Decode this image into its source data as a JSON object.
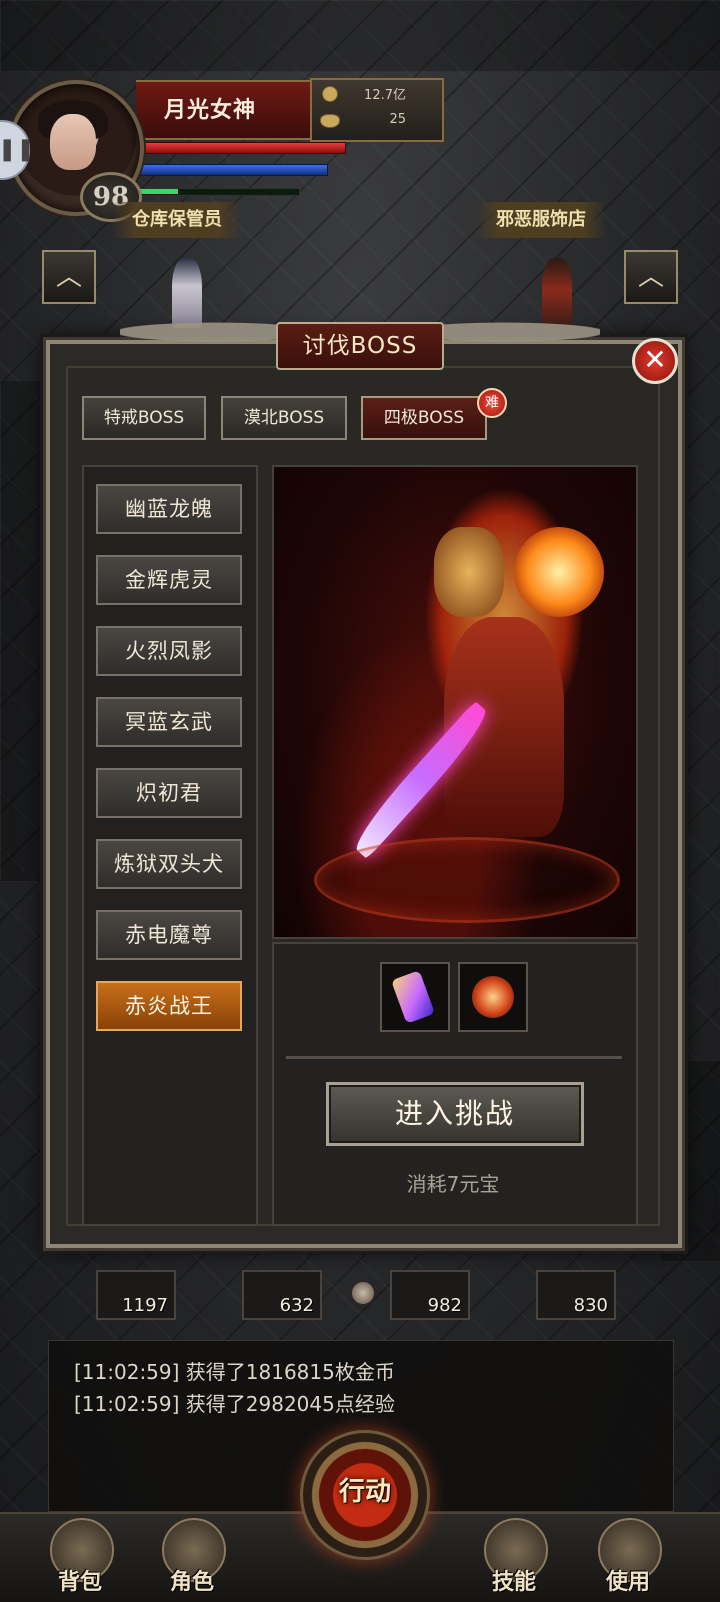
{
  "player": {
    "name": "月光女神",
    "level": "98",
    "gold": "12.7亿",
    "ingots": "25"
  },
  "npc_labels": {
    "left": "仓库保管员",
    "right": "邪恶服饰店"
  },
  "modal": {
    "title": "讨伐BOSS",
    "tabs": [
      {
        "label": "特戒BOSS",
        "active": false
      },
      {
        "label": "漠北BOSS",
        "active": false
      },
      {
        "label": "四极BOSS",
        "active": true
      }
    ],
    "hard_badge": "难",
    "boss_list": [
      {
        "label": "幽蓝龙魄",
        "active": false
      },
      {
        "label": "金辉虎灵",
        "active": false
      },
      {
        "label": "火烈凤影",
        "active": false
      },
      {
        "label": "冥蓝玄武",
        "active": false
      },
      {
        "label": "炽初君",
        "active": false
      },
      {
        "label": "炼狱双头犬",
        "active": false
      },
      {
        "label": "赤电魔尊",
        "active": false
      },
      {
        "label": "赤炎战王",
        "active": true
      }
    ],
    "challenge_button": "进入挑战",
    "cost_text": "消耗7元宝"
  },
  "under_items": [
    "1197",
    "632",
    "982",
    "830"
  ],
  "log": [
    "[11:02:59] 获得了1816815枚金币",
    "[11:02:59] 获得了2982045点经验"
  ],
  "bottom_nav": {
    "bag": "背包",
    "character": "角色",
    "action": "行动",
    "skills": "技能",
    "use": "使用"
  },
  "colors": {
    "active_tab": "#5b1f16",
    "active_boss": "#c7701a",
    "hp": "#f03a3a",
    "mp": "#3d6ef0",
    "xp": "#3fd36b"
  }
}
